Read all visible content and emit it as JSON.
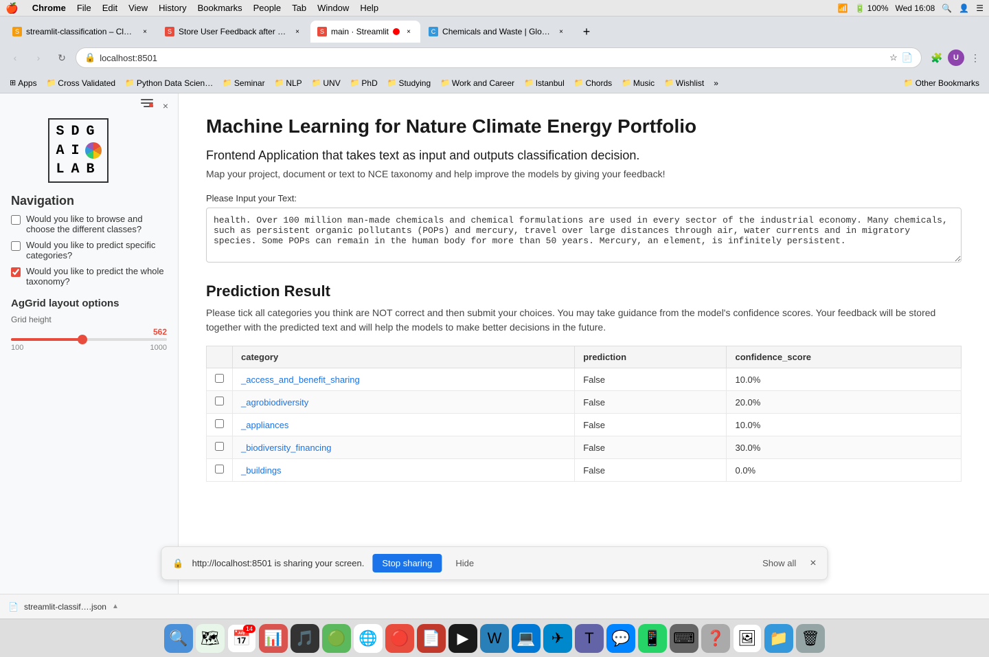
{
  "menubar": {
    "apple": "🍎",
    "items": [
      "Chrome",
      "File",
      "Edit",
      "View",
      "History",
      "Bookmarks",
      "People",
      "Tab",
      "Window",
      "Help"
    ],
    "right": {
      "time": "Wed 16:08",
      "battery": "100%",
      "wifi": "WiFi"
    }
  },
  "tabs": [
    {
      "id": "tab1",
      "title": "streamlit-classification – Clou…",
      "active": false,
      "favicon_color": "#f39c12"
    },
    {
      "id": "tab2",
      "title": "Store User Feedback after mo…",
      "active": false,
      "favicon_color": "#e74c3c"
    },
    {
      "id": "tab3",
      "title": "main · Streamlit",
      "active": true,
      "favicon_color": "#e74c3c",
      "recording": true
    },
    {
      "id": "tab4",
      "title": "Chemicals and Waste | Global…",
      "active": false,
      "favicon_color": "#3498db"
    }
  ],
  "address_bar": {
    "url": "localhost:8501"
  },
  "bookmarks": [
    {
      "label": "Apps",
      "icon": "⊞"
    },
    {
      "label": "Cross Validated",
      "icon": "📁"
    },
    {
      "label": "Python Data Scien…",
      "icon": "📁"
    },
    {
      "label": "Seminar",
      "icon": "📁"
    },
    {
      "label": "NLP",
      "icon": "📁"
    },
    {
      "label": "UNV",
      "icon": "📁"
    },
    {
      "label": "PhD",
      "icon": "📁"
    },
    {
      "label": "Studying",
      "icon": "📁"
    },
    {
      "label": "Work and Career",
      "icon": "📁"
    },
    {
      "label": "Istanbul",
      "icon": "📁"
    },
    {
      "label": "Chords",
      "icon": "📁"
    },
    {
      "label": "Music",
      "icon": "📁"
    },
    {
      "label": "Wishlist",
      "icon": "📁"
    },
    {
      "label": "»",
      "icon": ""
    },
    {
      "label": "Other Bookmarks",
      "icon": "📁"
    }
  ],
  "sidebar": {
    "nav_title": "Navigation",
    "nav_items": [
      {
        "label": "Would you like to browse and choose the different classes?",
        "checked": false
      },
      {
        "label": "Would you like to predict specific categories?",
        "checked": false
      },
      {
        "label": "Would you like to predict the whole taxonomy?",
        "checked": true
      }
    ],
    "section_title": "AgGrid layout options",
    "grid_height_label": "Grid height",
    "slider_value": "562",
    "slider_min": "100",
    "slider_max": "1000",
    "slider_pct": 46
  },
  "main": {
    "title": "Machine Learning for Nature Climate Energy Portfolio",
    "subtitle": "Frontend Application that takes text as input and outputs classification decision.",
    "description": "Map your project, document or text to NCE taxonomy and help improve the models by giving your feedback!",
    "input_label": "Please Input your Text:",
    "input_text": "health. Over 100 million man-made chemicals and chemical formulations are used in every sector of the industrial economy. Many chemicals, such as persistent organic pollutants (POPs) and mercury, travel over large distances through air, water currents and in migratory species. Some POPs can remain in the human body for more than 50 years. Mercury, an element, is infinitely persistent.",
    "prediction_heading": "Prediction Result",
    "prediction_desc": "Please tick all categories you think are NOT correct and then submit your choices. You may take guidance from the model's confidence scores. Your feedback will be stored together with the predicted text and will help the models to make better decisions in the future.",
    "table": {
      "headers": [
        "category",
        "prediction",
        "confidence_score"
      ],
      "rows": [
        {
          "checked": false,
          "category": "_access_and_benefit_sharing",
          "prediction": "False",
          "confidence": "10.0%"
        },
        {
          "checked": false,
          "category": "_agrobiodiversity",
          "prediction": "False",
          "confidence": "20.0%"
        },
        {
          "checked": false,
          "category": "_appliances",
          "prediction": "False",
          "confidence": "10.0%"
        },
        {
          "checked": false,
          "category": "_biodiversity_financing",
          "prediction": "False",
          "confidence": "30.0%"
        },
        {
          "checked": false,
          "category": "_buildings",
          "prediction": "False",
          "confidence": "0.0%"
        }
      ]
    }
  },
  "notification": {
    "icon": "🔒",
    "text": "http://localhost:8501 is sharing your screen.",
    "stop_btn": "Stop sharing",
    "hide_btn": "Hide",
    "show_all": "Show all",
    "close": "×"
  },
  "download_bar": {
    "filename": "streamlit-classif….json",
    "chevron": "▲"
  },
  "dock": {
    "items": [
      {
        "icon": "🔍",
        "label": "Finder"
      },
      {
        "icon": "🗺",
        "label": "Maps"
      },
      {
        "icon": "📅",
        "label": "Calendar",
        "badge": "14"
      },
      {
        "icon": "📊",
        "label": "PowerPoint"
      },
      {
        "icon": "🎵",
        "label": "Music"
      },
      {
        "icon": "🟢",
        "label": "WhatsApp-like"
      },
      {
        "icon": "🌐",
        "label": "Chrome"
      },
      {
        "icon": "🔴",
        "label": "App"
      },
      {
        "icon": "📄",
        "label": "PDF"
      },
      {
        "icon": "🖥",
        "label": "Terminal"
      },
      {
        "icon": "📝",
        "label": "Word"
      },
      {
        "icon": "💻",
        "label": "VSCode"
      },
      {
        "icon": "✈️",
        "label": "Telegram"
      },
      {
        "icon": "🔵",
        "label": "Teams"
      },
      {
        "icon": "💬",
        "label": "Messenger"
      },
      {
        "icon": "📱",
        "label": "Phone"
      },
      {
        "icon": "⌨️",
        "label": "Keyboard"
      },
      {
        "icon": "❓",
        "label": "Help"
      },
      {
        "icon": "🖼",
        "label": "Preview"
      },
      {
        "icon": "📁",
        "label": "Finder2"
      },
      {
        "icon": "🗑",
        "label": "Trash"
      }
    ]
  }
}
